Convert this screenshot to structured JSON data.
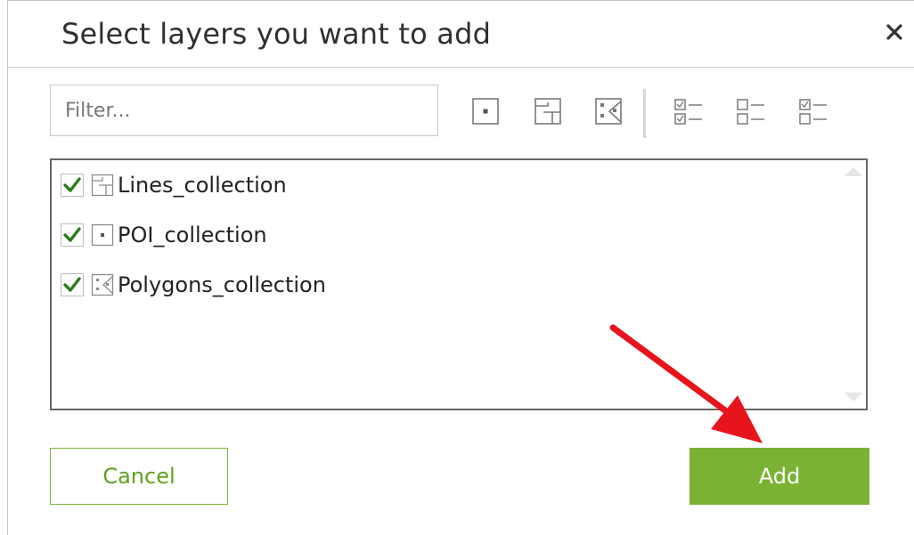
{
  "dialog": {
    "title": "Select layers you want to add",
    "close_icon": "close-icon"
  },
  "filter": {
    "placeholder": "Filter...",
    "value": ""
  },
  "toolbar": {
    "icons": [
      "point-layer-filter-icon",
      "line-layer-filter-icon",
      "polygon-layer-filter-icon",
      "select-all-icon",
      "select-none-icon",
      "invert-selection-icon"
    ]
  },
  "layers": [
    {
      "label": "Lines_collection",
      "type_icon": "line-layer-icon",
      "checked": true
    },
    {
      "label": "POI_collection",
      "type_icon": "point-layer-icon",
      "checked": true
    },
    {
      "label": "Polygons_collection",
      "type_icon": "polygon-layer-icon",
      "checked": true
    }
  ],
  "buttons": {
    "cancel_label": "Cancel",
    "add_label": "Add"
  },
  "colors": {
    "accent": "#7ab234",
    "check": "#2a7d1a",
    "annotation_arrow": "#e8141c"
  }
}
